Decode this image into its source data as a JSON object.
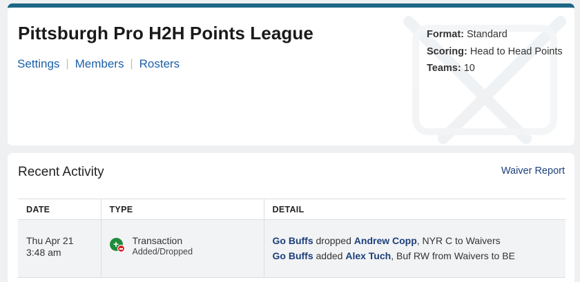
{
  "league": {
    "title": "Pittsburgh Pro H2H Points League",
    "nav": [
      {
        "label": "Settings"
      },
      {
        "label": "Members"
      },
      {
        "label": "Rosters"
      }
    ],
    "separator": "|",
    "info": {
      "format_key": "Format:",
      "format_value": "Standard",
      "scoring_key": "Scoring:",
      "scoring_value": "Head to Head Points",
      "teams_key": "Teams:",
      "teams_value": "10"
    }
  },
  "activity": {
    "title": "Recent Activity",
    "waiver_report": "Waiver Report",
    "columns": {
      "date": "DATE",
      "type": "TYPE",
      "detail": "DETAIL"
    },
    "rows": [
      {
        "date_line1": "Thu Apr 21",
        "date_line2": "3:48 am",
        "type": "Transaction",
        "subtype": "Added/Dropped",
        "details": [
          {
            "team": "Go Buffs",
            "action": " dropped ",
            "player": "Andrew Copp",
            "info": ", NYR C to Waivers"
          },
          {
            "team": "Go Buffs",
            "action": " added ",
            "player": "Alex Tuch",
            "info": ", Buf RW from Waivers to BE"
          }
        ]
      }
    ]
  },
  "colors": {
    "accent_bar": "#1e6784",
    "link": "#1b5fa8",
    "add_icon": "#1f8a3b",
    "drop_icon": "#d9252c"
  },
  "icons": {
    "watermark": "crossed-hockey-sticks-icon",
    "transaction": "add-drop-icon"
  }
}
